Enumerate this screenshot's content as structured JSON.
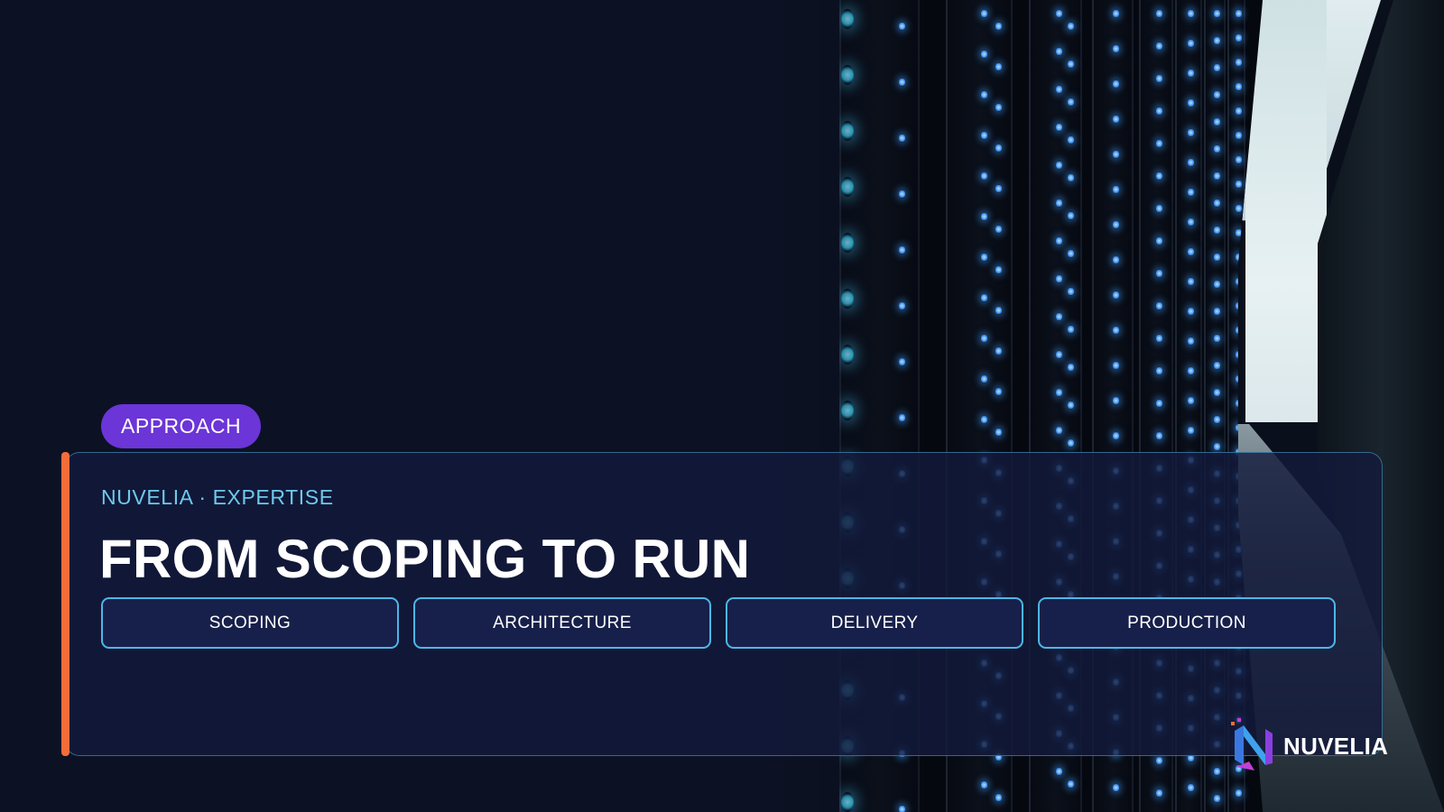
{
  "slide": {
    "tag": "APPROACH",
    "eyebrow": "NUVELIA · EXPERTISE",
    "title": "FROM SCOPING TO RUN",
    "steps": [
      {
        "label": "SCOPING"
      },
      {
        "label": "ARCHITECTURE"
      },
      {
        "label": "DELIVERY"
      },
      {
        "label": "PRODUCTION"
      }
    ]
  },
  "brand": {
    "name": "NUVELIA",
    "logo_icon": "nuvelia-logo-mark"
  },
  "background": {
    "image": "server-aisle-datacenter"
  },
  "colors": {
    "tag_bg": "#6b35d8",
    "accent_bar": "#f36d3a",
    "eyebrow": "#6fc8ee",
    "step_border": "#4fb6e6",
    "panel_bg": "#131a3c"
  }
}
